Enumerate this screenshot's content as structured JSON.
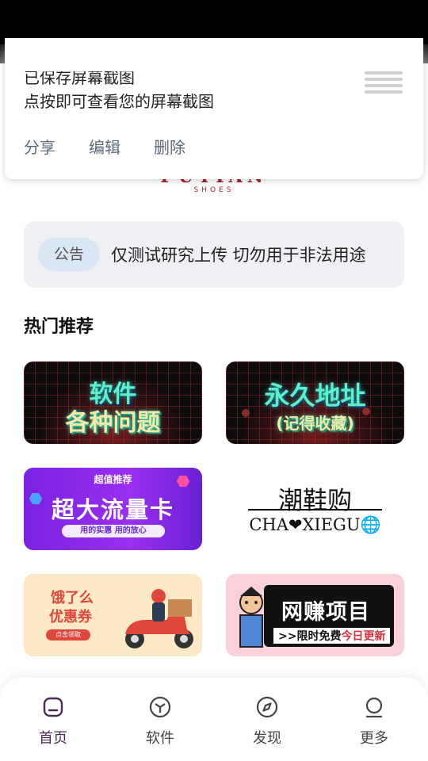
{
  "notification": {
    "line1": "已保存屏幕截图",
    "line2": "点按即可查看您的屏幕截图",
    "actions": [
      "分享",
      "编辑",
      "删除"
    ]
  },
  "logo": {
    "main": "PUTIAN",
    "sub": "SHOES"
  },
  "notice": {
    "tag": "公告",
    "text": "仅测试研究上传 切勿用于非法用途"
  },
  "section_title": "热门推荐",
  "cards": {
    "c1": {
      "line1": "软件",
      "line2": "各种问题"
    },
    "c2": {
      "line1": "永久地址",
      "line2": "(记得收藏)"
    },
    "c3": {
      "top": "超值推荐",
      "big": "超大流量卡",
      "pill": "用的实惠 用的放心"
    },
    "c4": {
      "cn": "潮鞋购",
      "en": "CHA❤XIEGU🌐"
    },
    "c5": {
      "line1": "饿了么",
      "line2": "优惠券",
      "button": "点击领取"
    },
    "c6": {
      "title": "网赚项目",
      "sub_prefix": ">>限时免费",
      "sub_highlight": "今日更新"
    }
  },
  "nav": [
    {
      "label": "首页",
      "icon": "home-icon",
      "active": true
    },
    {
      "label": "软件",
      "icon": "cube-icon",
      "active": false
    },
    {
      "label": "发现",
      "icon": "compass-icon",
      "active": false
    },
    {
      "label": "更多",
      "icon": "person-icon",
      "active": false
    }
  ],
  "colors": {
    "accent": "#4b2a52",
    "notice_tag_bg": "#d9e6f3",
    "notice_bg": "#eef0f3",
    "action_text": "#5c6b7a"
  }
}
